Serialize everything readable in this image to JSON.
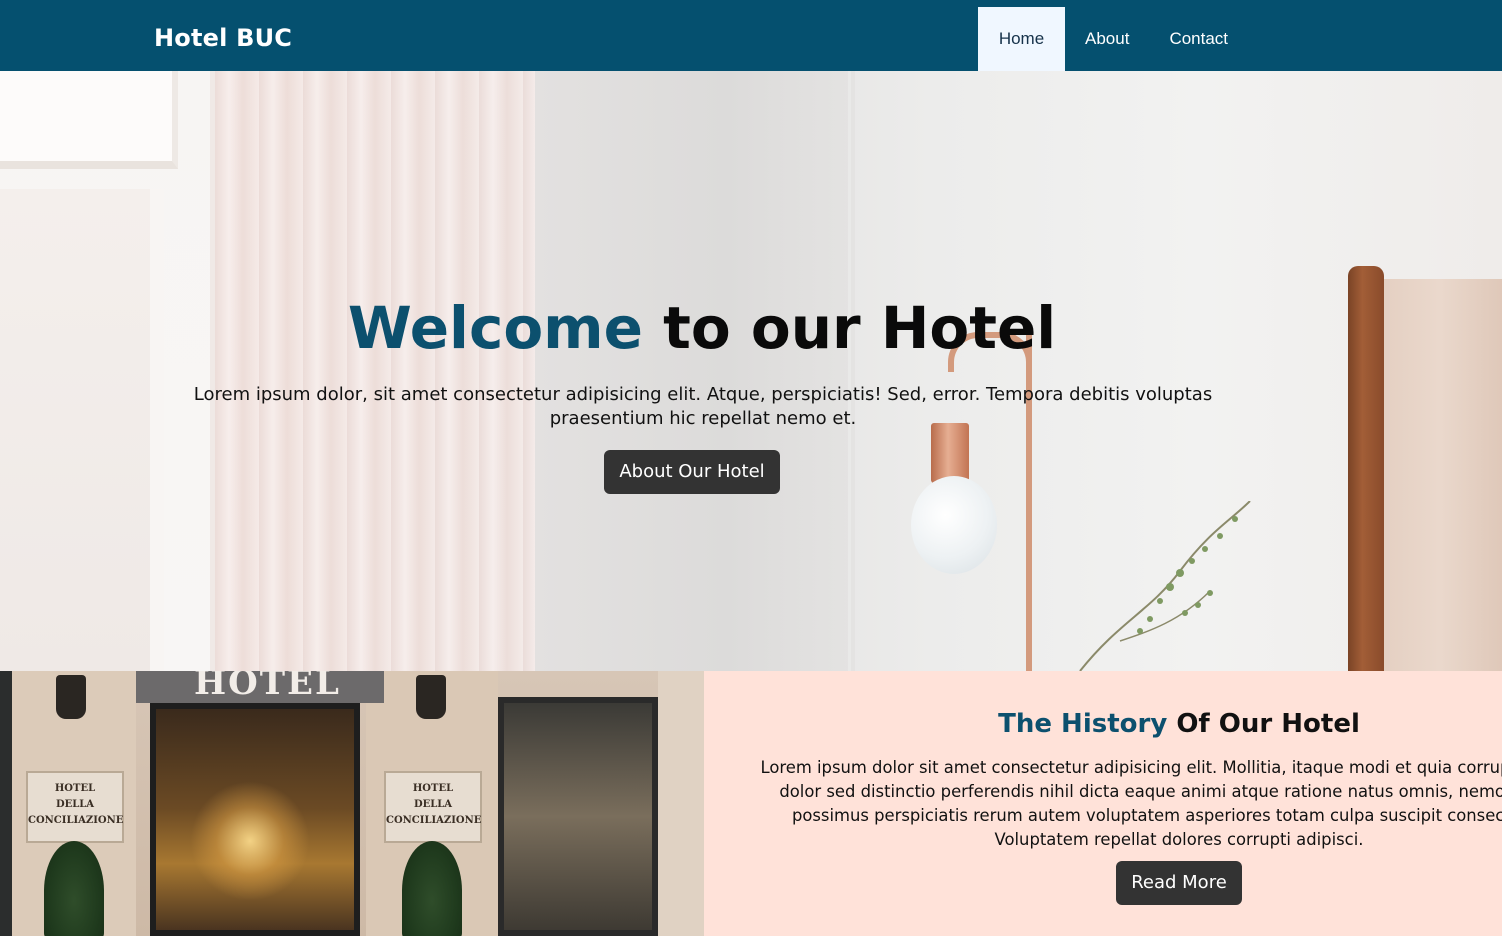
{
  "navbar": {
    "brand": "Hotel BUC",
    "links": [
      "Home",
      "About",
      "Contact"
    ],
    "active": "Home"
  },
  "hero": {
    "title_accent": "Welcome",
    "title_rest": " to our Hotel",
    "text_line1": "Lorem ipsum dolor, sit amet consectetur adipisicing elit. Atque, perspiciatis! Sed, error. Tempora debitis voluptas",
    "text_line2": "praesentium hic repellat nemo et.",
    "button": "About Our Hotel"
  },
  "hotel_image": {
    "awning_text": "HOTEL",
    "plaque_text": [
      "HOTEL",
      "DELLA",
      "CONCILIAZIONE"
    ]
  },
  "history": {
    "title_accent": "The History",
    "title_rest": " Of Our Hotel",
    "text_lines": [
      "Lorem ipsum dolor sit amet consectetur adipisicing elit. Mollitia, itaque modi et quia corrupti optio vol",
      "dolor sed distinctio perferendis nihil dicta eaque animi atque ratione natus omnis, nemo nostrum",
      "possimus perspiciatis rerum autem voluptatem asperiores totam culpa suscipit consectetur re",
      "Voluptatem repellat dolores corrupti adipisci."
    ],
    "button": "Read More"
  },
  "colors": {
    "navbar": "#05506f",
    "accent": "#0c506e",
    "history_bg": "#ffe2d9",
    "button": "#333333"
  }
}
